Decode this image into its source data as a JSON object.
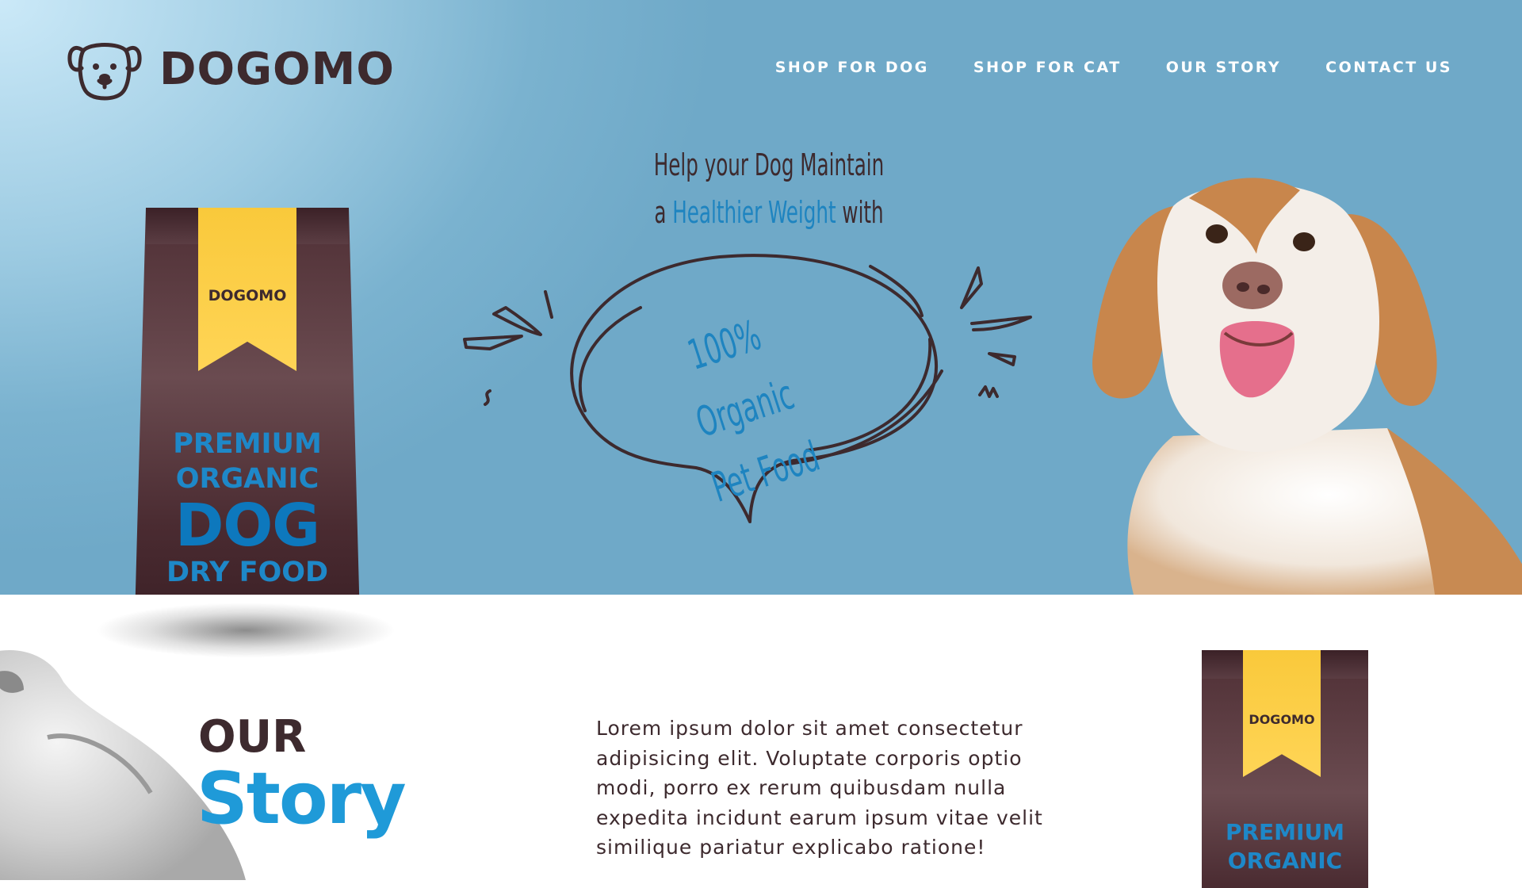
{
  "brand": {
    "name": "DOGOMO",
    "icon": "dog-face-icon"
  },
  "nav": {
    "items": [
      {
        "label": "SHOP FOR DOG"
      },
      {
        "label": "SHOP FOR CAT"
      },
      {
        "label": "OUR STORY"
      },
      {
        "label": "CONTACT US"
      }
    ]
  },
  "hero": {
    "tagline_line1": "Help your Dog Maintain",
    "tagline_prefix": "a",
    "tagline_highlight": "Healthier Weight",
    "tagline_suffix": "with",
    "bubble_line1": "100% Organic",
    "bubble_line2": "Pet Food"
  },
  "product_bag": {
    "brand": "DOGOMO",
    "line1": "PREMIUM",
    "line2": "ORGANIC",
    "line3": "DOG",
    "line4": "DRY FOOD"
  },
  "story": {
    "title_top": "OUR",
    "title_bottom": "Story",
    "body": "Lorem ipsum dolor sit amet consectetur adipisicing elit. Voluptate corporis optio modi, porro ex rerum quibusdam nulla expedita incidunt earum ipsum vitae velit similique pariatur explicabo ratione!"
  },
  "product_bag_small": {
    "brand": "DOGOMO",
    "line1": "PREMIUM",
    "line2": "ORGANIC"
  },
  "colors": {
    "brand_dark": "#3d2a2e",
    "accent_blue": "#1e84c0",
    "ribbon_yellow": "#ffd556",
    "hero_blue": "#6fa9c8"
  }
}
